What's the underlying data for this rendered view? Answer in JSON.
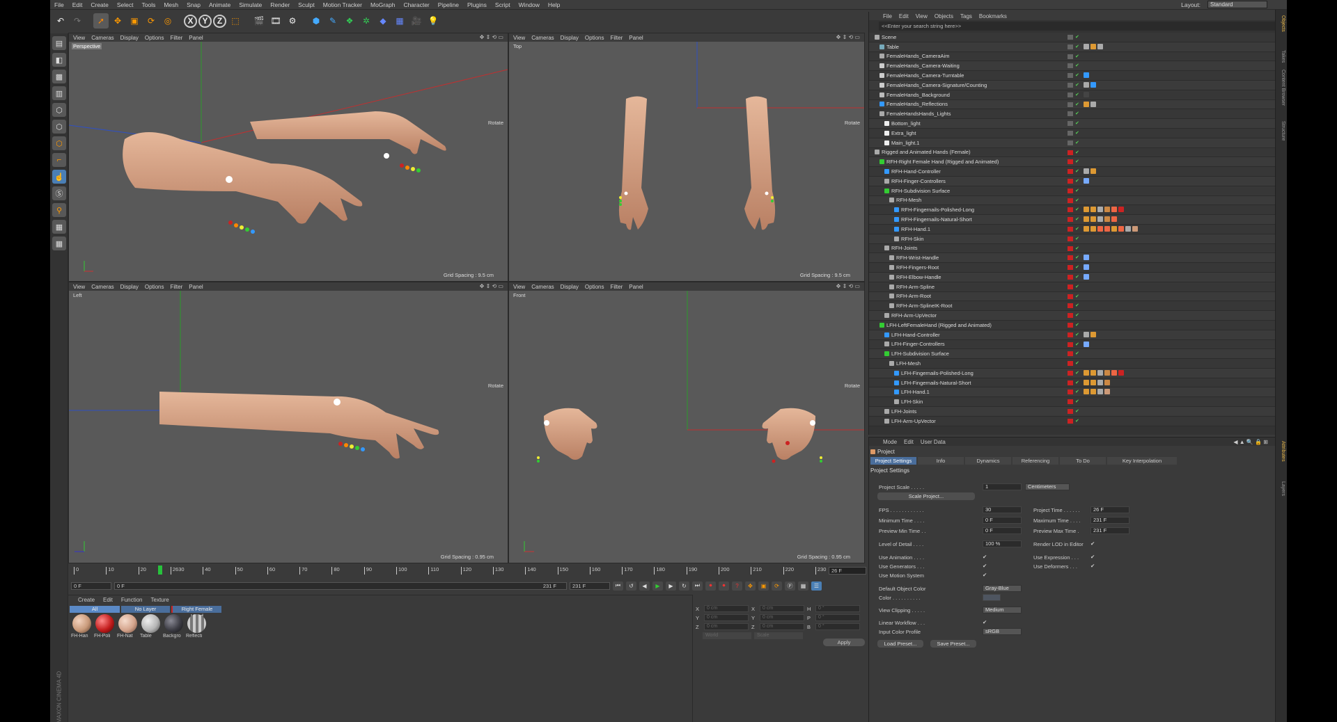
{
  "menubar": {
    "items": [
      "File",
      "Edit",
      "Create",
      "Select",
      "Tools",
      "Mesh",
      "Snap",
      "Animate",
      "Simulate",
      "Render",
      "Sculpt",
      "Motion Tracker",
      "MoGraph",
      "Character",
      "Pipeline",
      "Plugins",
      "Script",
      "Window",
      "Help"
    ],
    "layout_label": "Layout:",
    "layout_value": "Standard"
  },
  "toolbar": {
    "icons": [
      "undo-icon",
      "redo-icon",
      "select-icon",
      "move-icon",
      "scale-icon",
      "rotate-icon",
      "recent-icon",
      "x-axis-icon",
      "y-axis-icon",
      "z-axis-icon",
      "world-coords-icon",
      "render-view-icon",
      "render-picture-icon",
      "render-settings-icon",
      "cube-icon",
      "pen-icon",
      "subdivision-icon",
      "array-icon",
      "deformer-icon",
      "floor-icon",
      "camera-icon",
      "light-icon"
    ],
    "axes": [
      "X",
      "Y",
      "Z"
    ]
  },
  "viewports": [
    {
      "menu": [
        "View",
        "Cameras",
        "Display",
        "Options",
        "Filter",
        "Panel"
      ],
      "name": "Perspective",
      "rotate": "Rotate",
      "grid": "Grid Spacing : 9.5 cm"
    },
    {
      "menu": [
        "View",
        "Cameras",
        "Display",
        "Options",
        "Filter",
        "Panel"
      ],
      "name": "Top",
      "rotate": "Rotate",
      "grid": "Grid Spacing : 9.5 cm"
    },
    {
      "menu": [
        "View",
        "Cameras",
        "Display",
        "Options",
        "Filter",
        "Panel"
      ],
      "name": "Left",
      "rotate": "Rotate",
      "grid": "Grid Spacing : 0.95 cm"
    },
    {
      "menu": [
        "View",
        "Cameras",
        "Display",
        "Options",
        "Filter",
        "Panel"
      ],
      "name": "Front",
      "rotate": "Rotate",
      "grid": "Grid Spacing : 0.95 cm"
    }
  ],
  "timeline": {
    "ticks": [
      "0",
      "10",
      "20",
      "2630",
      "40",
      "50",
      "60",
      "70",
      "80",
      "90",
      "100",
      "110",
      "120",
      "130",
      "140",
      "150",
      "160",
      "170",
      "180",
      "190",
      "200",
      "210",
      "220",
      "230"
    ],
    "current_frame": "26 F",
    "start": "0 F",
    "start2": "0 F",
    "end_inner": "231 F",
    "end": "231 F"
  },
  "materials": {
    "menu": [
      "Create",
      "Edit",
      "Function",
      "Texture"
    ],
    "tabs": [
      "All",
      "No Layer",
      "Right Female Hand"
    ],
    "items": [
      {
        "name": "FH-Han",
        "color": "#c99a7a"
      },
      {
        "name": "FH-Poli",
        "color": "#c21c1c"
      },
      {
        "name": "FH-Nat",
        "color": "#d4a48c"
      },
      {
        "name": "Table",
        "color": "#b5b5b5"
      },
      {
        "name": "Backgro",
        "color": "#3c3c44"
      },
      {
        "name": "Reflecti",
        "color": "#999999"
      }
    ]
  },
  "coordinates": {
    "rows": [
      [
        "X",
        "0 cm",
        "X",
        "0 cm",
        "H",
        "0 °"
      ],
      [
        "Y",
        "0 cm",
        "Y",
        "0 cm",
        "P",
        "0 °"
      ],
      [
        "Z",
        "0 cm",
        "Z",
        "0 cm",
        "B",
        "0 °"
      ]
    ],
    "mode1": "World",
    "mode2": "Scale",
    "apply": "Apply"
  },
  "objects": {
    "menu": [
      "File",
      "Edit",
      "View",
      "Objects",
      "Tags",
      "Bookmarks"
    ],
    "search": "<<Enter your search string here>>",
    "rows": [
      {
        "name": "Scene",
        "depth": 0,
        "color": "#aaa",
        "stat": "#666"
      },
      {
        "name": "Table",
        "depth": 1,
        "color": "#7ab",
        "stat": "#666",
        "tags": [
          "#aaa",
          "#d93",
          "#aaa"
        ]
      },
      {
        "name": "FemaleHands_CameraAim",
        "depth": 1,
        "color": "#aaa",
        "stat": "#666"
      },
      {
        "name": "FemaleHands_Camera-Waiting",
        "depth": 1,
        "color": "#ccc",
        "stat": "#666"
      },
      {
        "name": "FemaleHands_Camera-Turntable",
        "depth": 1,
        "color": "#ccc",
        "stat": "#666",
        "tags": [
          "#39f"
        ]
      },
      {
        "name": "FemaleHands_Camera-Signature/Counting",
        "depth": 1,
        "color": "#ccc",
        "stat": "#666",
        "tags": [
          "#aaa",
          "#39f"
        ]
      },
      {
        "name": "FemaleHands_Background",
        "depth": 1,
        "color": "#bbb",
        "stat": "#666",
        "tags": [
          "#444"
        ]
      },
      {
        "name": "FemaleHands_Reflections",
        "depth": 1,
        "color": "#39f",
        "stat": "#666",
        "tags": [
          "#d93",
          "#aaa"
        ]
      },
      {
        "name": "FemaleHandsHands_Lights",
        "depth": 1,
        "color": "#aaa",
        "stat": "#666"
      },
      {
        "name": "Bottom_light",
        "depth": 2,
        "color": "#eee",
        "stat": "#666"
      },
      {
        "name": "Extra_light",
        "depth": 2,
        "color": "#eee",
        "stat": "#666"
      },
      {
        "name": "Main_light.1",
        "depth": 2,
        "color": "#eee",
        "stat": "#666"
      },
      {
        "name": "Rigged and Animated Hands (Female)",
        "depth": 0,
        "color": "#aaa",
        "stat": "#c22"
      },
      {
        "name": "RFH-Right Female Hand (Rigged and Animated)",
        "depth": 1,
        "color": "#3c3",
        "stat": "#c22"
      },
      {
        "name": "RFH-Hand-Controller",
        "depth": 2,
        "color": "#39f",
        "stat": "#c22",
        "tags": [
          "#aaa",
          "#d93"
        ]
      },
      {
        "name": "RFH-Finger-Controllers",
        "depth": 2,
        "color": "#aaa",
        "stat": "#c22",
        "tags": [
          "#7af"
        ]
      },
      {
        "name": "RFH-Subdivision Surface",
        "depth": 2,
        "color": "#3c3",
        "stat": "#c22"
      },
      {
        "name": "RFH-Mesh",
        "depth": 3,
        "color": "#aaa",
        "stat": "#c22"
      },
      {
        "name": "RFH-Fingernails-Polished-Long",
        "depth": 4,
        "color": "#39f",
        "stat": "#c22",
        "tags": [
          "#d93",
          "#d93",
          "#aaa",
          "#c84",
          "#e64",
          "#c22"
        ]
      },
      {
        "name": "RFH-Fingernails-Natural-Short",
        "depth": 4,
        "color": "#39f",
        "stat": "#c22",
        "tags": [
          "#d93",
          "#d93",
          "#aaa",
          "#c84",
          "#e64"
        ]
      },
      {
        "name": "RFH-Hand.1",
        "depth": 4,
        "color": "#39f",
        "stat": "#c22",
        "tags": [
          "#d93",
          "#d93",
          "#e64",
          "#e64",
          "#d93",
          "#e64",
          "#aaa",
          "#c97"
        ]
      },
      {
        "name": "RFH-Skin",
        "depth": 4,
        "color": "#aaa",
        "stat": "#c22"
      },
      {
        "name": "RFH-Joints",
        "depth": 2,
        "color": "#aaa",
        "stat": "#c22"
      },
      {
        "name": "RFH-Wrist-Handle",
        "depth": 3,
        "color": "#aaa",
        "stat": "#c22",
        "tags": [
          "#7af"
        ]
      },
      {
        "name": "RFH-Fingers-Root",
        "depth": 3,
        "color": "#aaa",
        "stat": "#c22",
        "tags": [
          "#7af"
        ]
      },
      {
        "name": "RFH-Elbow-Handle",
        "depth": 3,
        "color": "#aaa",
        "stat": "#c22",
        "tags": [
          "#7af"
        ]
      },
      {
        "name": "RFH-Arm-Spline",
        "depth": 3,
        "color": "#aaa",
        "stat": "#c22"
      },
      {
        "name": "RFH-Arm-Root",
        "depth": 3,
        "color": "#aaa",
        "stat": "#c22"
      },
      {
        "name": "RFH-Arm-SplineIK-Root",
        "depth": 3,
        "color": "#aaa",
        "stat": "#c22"
      },
      {
        "name": "RFH-Arm-UpVector",
        "depth": 2,
        "color": "#aaa",
        "stat": "#c22"
      },
      {
        "name": "LFH-LeftFemaleHand (Rigged and Animated)",
        "depth": 1,
        "color": "#3c3",
        "stat": "#c22"
      },
      {
        "name": "LFH-Hand-Controller",
        "depth": 2,
        "color": "#39f",
        "stat": "#c22",
        "tags": [
          "#aaa",
          "#d93"
        ]
      },
      {
        "name": "LFH-Finger-Controllers",
        "depth": 2,
        "color": "#aaa",
        "stat": "#c22",
        "tags": [
          "#7af"
        ]
      },
      {
        "name": "LFH-Subdivision Surface",
        "depth": 2,
        "color": "#3c3",
        "stat": "#c22"
      },
      {
        "name": "LFH-Mesh",
        "depth": 3,
        "color": "#aaa",
        "stat": "#c22"
      },
      {
        "name": "LFH-Fingernails-Polished-Long",
        "depth": 4,
        "color": "#39f",
        "stat": "#c22",
        "tags": [
          "#d93",
          "#d93",
          "#aaa",
          "#c84",
          "#e64",
          "#c22"
        ]
      },
      {
        "name": "LFH-Fingernails-Natural-Short",
        "depth": 4,
        "color": "#39f",
        "stat": "#c22",
        "tags": [
          "#d93",
          "#d93",
          "#aaa",
          "#c84"
        ]
      },
      {
        "name": "LFH-Hand.1",
        "depth": 4,
        "color": "#39f",
        "stat": "#c22",
        "tags": [
          "#d93",
          "#d93",
          "#aaa",
          "#c97"
        ]
      },
      {
        "name": "LFH-Skin",
        "depth": 4,
        "color": "#aaa",
        "stat": "#c22"
      },
      {
        "name": "LFH-Joints",
        "depth": 2,
        "color": "#aaa",
        "stat": "#c22"
      },
      {
        "name": "LFH-Arm-UpVector",
        "depth": 2,
        "color": "#aaa",
        "stat": "#c22"
      }
    ]
  },
  "attributes": {
    "menu": [
      "Mode",
      "Edit",
      "User Data"
    ],
    "title": "Project",
    "tabs": [
      "Project Settings",
      "Info",
      "Dynamics",
      "Referencing",
      "To Do",
      "Key Interpolation"
    ],
    "section": "Project Settings",
    "project_scale_label": "Project Scale . . . . .",
    "project_scale": "1",
    "units": "Centimeters",
    "scale_btn": "Scale Project...",
    "fps_label": "FPS . . . . . . . . . . . .",
    "fps": "30",
    "ptime_label": "Project Time . . . . . .",
    "ptime": "26 F",
    "mintime_label": "Minimum Time . . . .",
    "mintime": "0 F",
    "maxtime_label": "Maximum Time . . . .",
    "maxtime": "231 F",
    "pmin_label": "Preview Min Time . .",
    "pmin": "0 F",
    "pmax_label": "Preview Max Time .",
    "pmax": "231 F",
    "lod_label": "Level of Detail . . . .",
    "lod": "100 %",
    "renderlod_label": "Render LOD in Editor",
    "useanim_label": "Use Animation . . . .",
    "useexpr_label": "Use Expression . . .",
    "usegen_label": "Use Generators . . .",
    "usedef_label": "Use Deformers . . .",
    "usemotion_label": "Use Motion System",
    "defcolor_label": "Default Object Color",
    "defcolor": "Gray-Blue",
    "color_label": "Color . . . . . . . . . .",
    "clip_label": "View Clipping . . . . .",
    "clip": "Medium",
    "linear_label": "Linear Workflow . . .",
    "profile_label": "Input Color Profile",
    "profile": "sRGB",
    "load_btn": "Load Preset...",
    "save_btn": "Save Preset...",
    "check": "✔"
  },
  "side_tabs": [
    "Objects",
    "Takes",
    "Content Browser",
    "Structure",
    "Attributes",
    "Layers"
  ],
  "brand": "MAXON CINEMA 4D"
}
